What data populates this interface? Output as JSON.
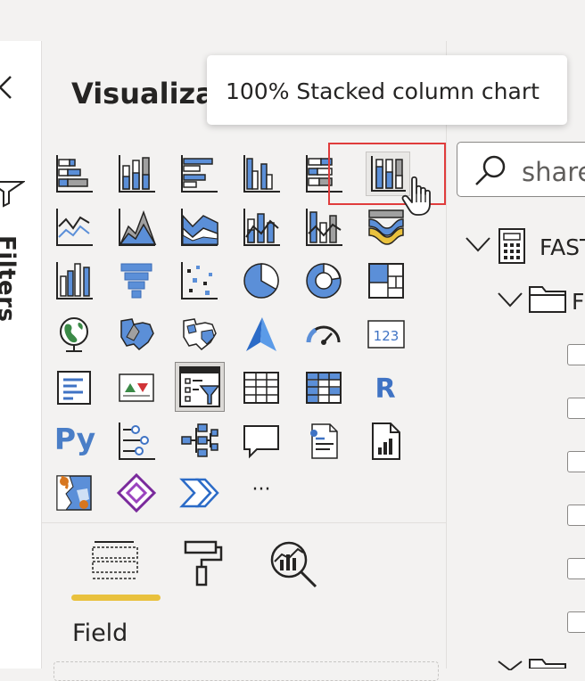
{
  "filters_pane": {
    "label": "Filters",
    "collapse_icon": "chevron-left-icon",
    "filter_icon": "funnel-icon"
  },
  "viz_pane": {
    "title": "Visualiza",
    "tooltip": "100% Stacked column chart",
    "selected_visual": "100% Stacked column chart",
    "visuals": [
      {
        "icon": "stacked-bar-chart-icon"
      },
      {
        "icon": "stacked-column-chart-icon"
      },
      {
        "icon": "clustered-bar-chart-icon"
      },
      {
        "icon": "clustered-column-chart-icon"
      },
      {
        "icon": "100-stacked-bar-chart-icon"
      },
      {
        "icon": "100-stacked-column-chart-icon"
      },
      {
        "icon": "line-chart-icon"
      },
      {
        "icon": "area-chart-icon"
      },
      {
        "icon": "stacked-area-chart-icon"
      },
      {
        "icon": "line-and-stacked-column-chart-icon"
      },
      {
        "icon": "line-and-clustered-column-chart-icon"
      },
      {
        "icon": "ribbon-chart-icon"
      },
      {
        "icon": "waterfall-chart-icon"
      },
      {
        "icon": "funnel-chart-icon"
      },
      {
        "icon": "scatter-chart-icon"
      },
      {
        "icon": "pie-chart-icon"
      },
      {
        "icon": "donut-chart-icon"
      },
      {
        "icon": "treemap-icon"
      },
      {
        "icon": "map-icon"
      },
      {
        "icon": "filled-map-icon"
      },
      {
        "icon": "shape-map-icon"
      },
      {
        "icon": "azure-map-icon"
      },
      {
        "icon": "gauge-icon"
      },
      {
        "icon": "card-icon",
        "text": "123"
      },
      {
        "icon": "multi-row-card-icon"
      },
      {
        "icon": "kpi-icon"
      },
      {
        "icon": "slicer-icon"
      },
      {
        "icon": "table-icon"
      },
      {
        "icon": "matrix-icon"
      },
      {
        "icon": "r-script-visual-icon",
        "text": "R"
      },
      {
        "icon": "python-visual-icon",
        "text": "Py"
      },
      {
        "icon": "key-influencers-icon"
      },
      {
        "icon": "decomposition-tree-icon"
      },
      {
        "icon": "qna-icon"
      },
      {
        "icon": "smart-narrative-icon"
      },
      {
        "icon": "paginated-report-icon"
      },
      {
        "icon": "arcgis-map-icon"
      },
      {
        "icon": "power-apps-icon"
      },
      {
        "icon": "power-automate-icon"
      },
      {
        "icon": "more-visuals-icon",
        "text": "···"
      }
    ],
    "tabs": [
      {
        "name": "fields-tab",
        "icon": "fields-well-icon"
      },
      {
        "name": "format-tab",
        "icon": "paint-roller-icon"
      },
      {
        "name": "analytics-tab",
        "icon": "analytics-magnifier-icon"
      }
    ],
    "active_tab_label": "Field",
    "accent_color": "#e9c13d"
  },
  "fields_pane": {
    "search": {
      "value": "share",
      "icon": "search-icon"
    },
    "tree": [
      {
        "label": "FAST",
        "icon": "calculator-table-icon",
        "expanded": true
      },
      {
        "label": "F",
        "icon": "folder-icon",
        "expanded": true
      },
      {
        "label": "",
        "icon": "folder-icon",
        "expanded": false
      }
    ],
    "checkbox_count": 6
  },
  "colors": {
    "accent_blue": "#5b8fd8",
    "selection_red": "#e03c3c",
    "pane_bg": "#f3f2f1"
  }
}
